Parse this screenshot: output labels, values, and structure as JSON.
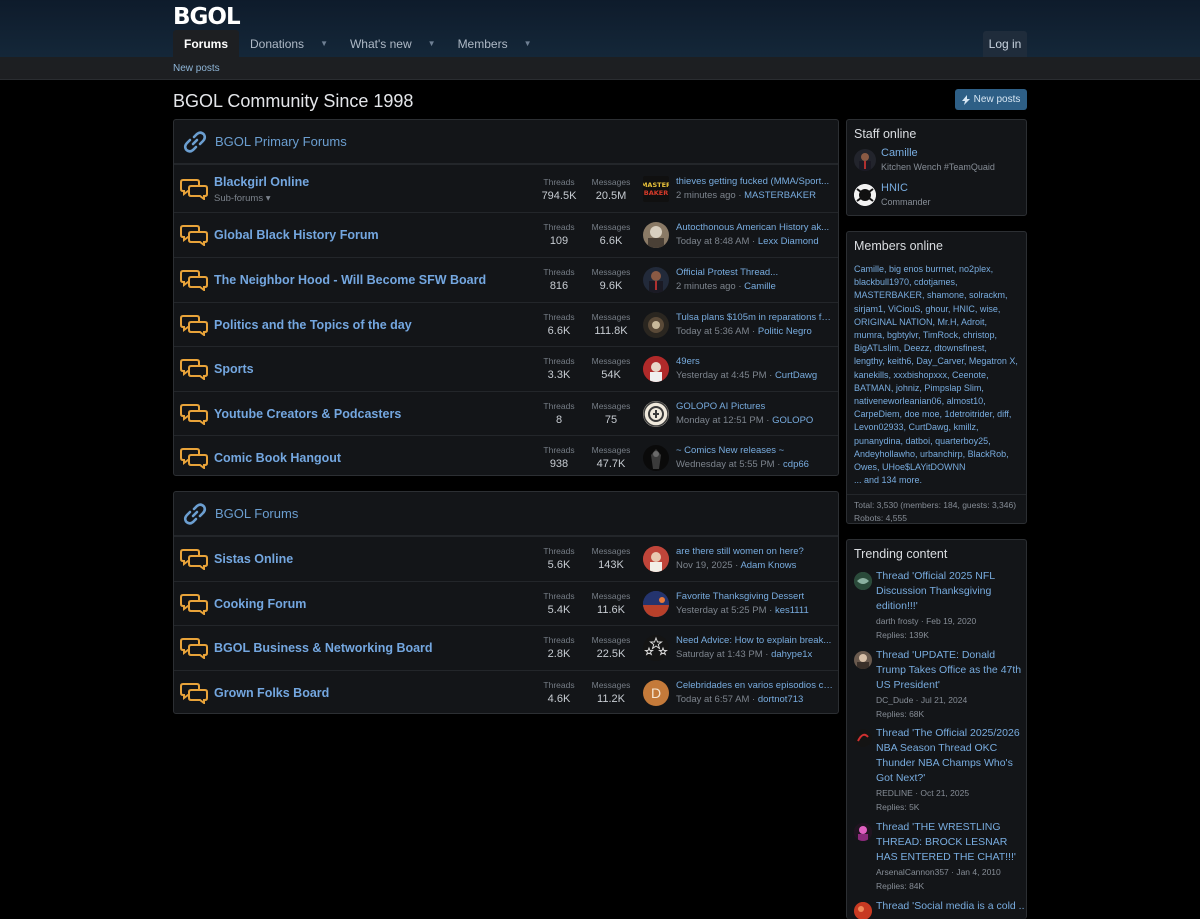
{
  "header": {
    "logo": "BGOL",
    "nav": [
      {
        "label": "Forums",
        "active": true
      },
      {
        "label": "Donations"
      },
      {
        "label": "What's new"
      },
      {
        "label": "Members"
      }
    ],
    "login": "Log in",
    "subnav_new_posts": "New posts"
  },
  "page": {
    "title": "BGOL Community Since 1998",
    "new_posts_button": "New posts"
  },
  "labels": {
    "threads": "Threads",
    "messages": "Messages"
  },
  "primary": {
    "title": "BGOL Primary Forums",
    "nodes": [
      {
        "title": "Blackgirl Online",
        "sub": "Sub-forums",
        "threads": "794.5K",
        "messages": "20.5M",
        "latest": "thieves getting fucked (MMA/Sport...",
        "time": "2 minutes ago",
        "user": "MASTERBAKER"
      },
      {
        "title": "Global Black History Forum",
        "threads": "109",
        "messages": "6.6K",
        "latest": "Autocthonous American History ak...",
        "time": "Today at 8:48 AM",
        "user": "Lexx Diamond"
      },
      {
        "title": "The Neighbor Hood - Will Become SFW Board",
        "threads": "816",
        "messages": "9.6K",
        "latest": "Official Protest Thread...",
        "time": "2 minutes ago",
        "user": "Camille"
      },
      {
        "title": "Politics and the Topics of the day",
        "threads": "6.6K",
        "messages": "111.8K",
        "latest": "Tulsa plans $105m in reparations fo...",
        "time": "Today at 5:36 AM",
        "user": "Politic Negro"
      },
      {
        "title": "Sports",
        "threads": "3.3K",
        "messages": "54K",
        "latest": "49ers",
        "time": "Yesterday at 4:45 PM",
        "user": "CurtDawg"
      },
      {
        "title": "Youtube Creators & Podcasters",
        "threads": "8",
        "messages": "75",
        "latest": "GOLOPO AI Pictures",
        "time": "Monday at 12:51 PM",
        "user": "GOLOPO"
      },
      {
        "title": "Comic Book Hangout",
        "threads": "938",
        "messages": "47.7K",
        "latest": "~ Comics New releases ~",
        "time": "Wednesday at 5:55 PM",
        "user": "cdp66"
      }
    ]
  },
  "forums": {
    "title": "BGOL Forums",
    "nodes": [
      {
        "title": "Sistas Online",
        "threads": "5.6K",
        "messages": "143K",
        "latest": "are there still women on here?",
        "time": "Nov 19, 2025",
        "user": "Adam Knows"
      },
      {
        "title": "Cooking Forum",
        "threads": "5.4K",
        "messages": "11.6K",
        "latest": "Favorite Thanksgiving Dessert",
        "time": "Yesterday at 5:25 PM",
        "user": "kes1111"
      },
      {
        "title": "BGOL Business & Networking Board",
        "threads": "2.8K",
        "messages": "22.5K",
        "latest": "Need Advice: How to explain break...",
        "time": "Saturday at 1:43 PM",
        "user": "dahype1x"
      },
      {
        "title": "Grown Folks Board",
        "threads": "4.6K",
        "messages": "11.2K",
        "latest": "Celebridades en varios episodios ca...",
        "time": "Today at 6:57 AM",
        "user": "dortnot713",
        "avatar_letter": "D"
      }
    ]
  },
  "staff": {
    "title": "Staff online",
    "members": [
      {
        "name": "Camille",
        "title": "Kitchen Wench #TeamQuaid"
      },
      {
        "name": "HNIC",
        "title": "Commander"
      }
    ]
  },
  "members_online": {
    "title": "Members online",
    "names": "Camille, big enos burrnet, no2plex, blackbull1970, cdotjames, MASTERBAKER, shamone, solrackm, sirjam1, ViCiouS, ghour, HNIC, wise, ORIGINAL NATION, Mr.H, Adroit, mumra, bgbtylvr, TimRock, christop, BigATLslim, Deezz, dtownsfinest, lengthy, keith6, Day_Carver, Megatron X, kanekills, xxxbishopxxx, Ceenote, BATMAN, johniz, Pimpslap Slim, nativeneworleanian06, almost10, CarpeDiem, doe moe, 1detroitrider, diff, Levon02933, CurtDawg, kmillz, punanydina, datboi, quarterboy25, Andeyhollawho, urbanchirp, BlackRob, Owes, UHoe$LAYitDOWNN",
    "more": "... and 134 more.",
    "totals": "Total: 3,530 (members: 184, guests: 3,346)",
    "robots": "Robots: 4,555"
  },
  "trending": {
    "title": "Trending content",
    "items": [
      {
        "title": "Thread 'Official 2025 NFL Discussion Thanksgiving edition!!!'",
        "meta": "darth frosty · Feb 19, 2020",
        "replies": "Replies: 139K"
      },
      {
        "title": "Thread 'UPDATE: Donald Trump Takes Office as the 47th US President'",
        "meta": "DC_Dude · Jul 21, 2024",
        "replies": "Replies: 68K"
      },
      {
        "title": "Thread 'The Official 2025/2026 NBA Season Thread OKC Thunder NBA Champs Who's Got Next?'",
        "meta": "REDLINE · Oct 21, 2025",
        "replies": "Replies: 5K"
      },
      {
        "title": "Thread 'THE WRESTLING THREAD: BROCK LESNAR HAS ENTERED THE CHAT!!!'",
        "meta": "ArsenalCannon357 · Jan 4, 2010",
        "replies": "Replies: 84K"
      },
      {
        "title": "Thread 'Social media is a cold ...'"
      }
    ]
  }
}
